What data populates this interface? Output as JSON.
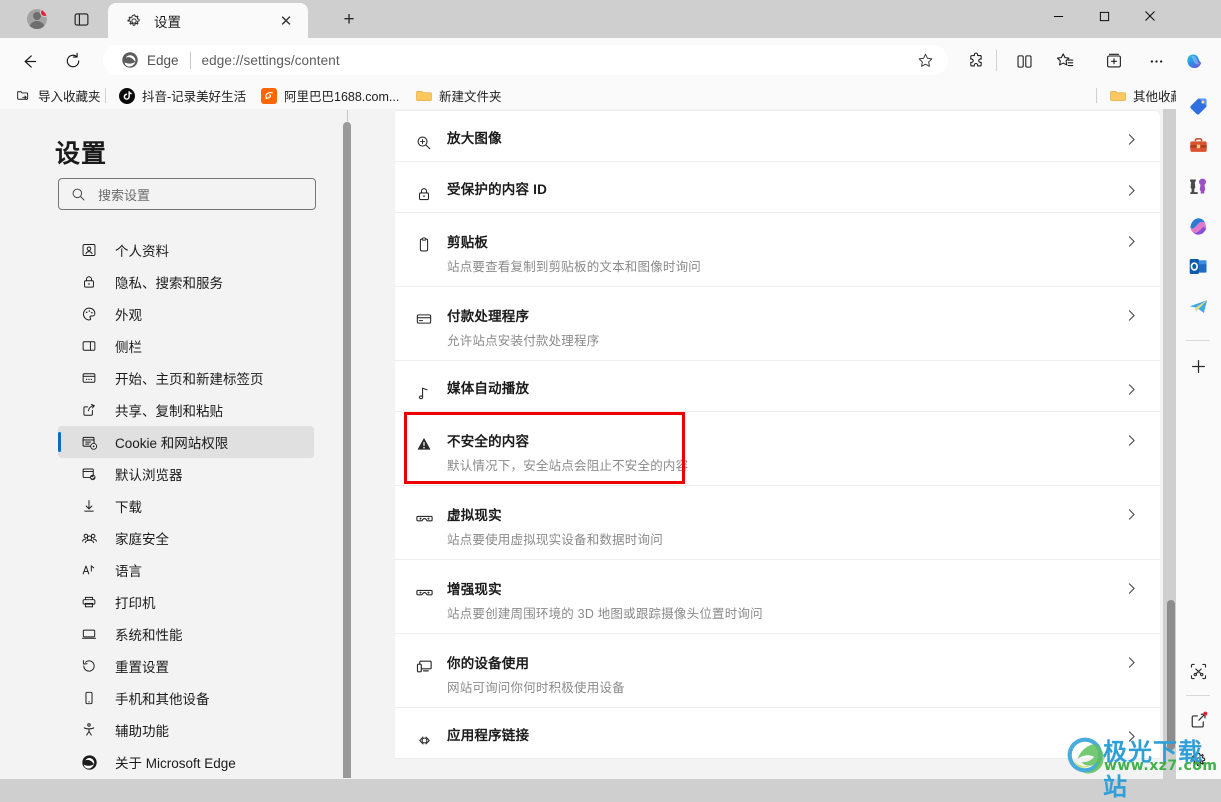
{
  "window": {
    "minimize_label": "—",
    "maximize_label": "□",
    "close_label": "✕"
  },
  "tab": {
    "title": "设置",
    "close_label": "✕",
    "new_tab_label": "+",
    "icon": "gear-icon"
  },
  "toolbar": {
    "back_icon": "back-arrow-icon",
    "reload_icon": "reload-icon",
    "omnibox": {
      "brand": "Edge",
      "url": "edge://settings/content",
      "star_icon": "favorite-star-icon"
    },
    "extensions_icon": "extensions-puzzle-icon",
    "split_screen_icon": "split-screen-icon",
    "favorites_icon": "favorites-star-list-icon",
    "collections_icon": "collections-icon",
    "more_icon": "more-ellipsis-icon",
    "copilot_icon": "copilot-icon"
  },
  "bookmarks": [
    {
      "label": "导入收藏夹",
      "icon": "import-favorites-icon"
    },
    {
      "label": "抖音-记录美好生活",
      "icon": "douyin-icon"
    },
    {
      "label": "阿里巴巴1688.com...",
      "icon": "alibaba-icon"
    },
    {
      "label": "新建文件夹",
      "icon": "folder-icon"
    }
  ],
  "bookmarks_right": {
    "label": "其他收藏夹",
    "icon": "folder-icon"
  },
  "settings": {
    "title": "设置",
    "search_placeholder": "搜索设置",
    "search_value": "",
    "nav": [
      {
        "label": "个人资料",
        "icon": "profile-icon",
        "selected": false
      },
      {
        "label": "隐私、搜索和服务",
        "icon": "lock-icon",
        "selected": false
      },
      {
        "label": "外观",
        "icon": "palette-icon",
        "selected": false
      },
      {
        "label": "侧栏",
        "icon": "sidebar-icon",
        "selected": false
      },
      {
        "label": "开始、主页和新建标签页",
        "icon": "home-page-icon",
        "selected": false
      },
      {
        "label": "共享、复制和粘贴",
        "icon": "share-icon",
        "selected": false
      },
      {
        "label": "Cookie 和网站权限",
        "icon": "cookie-permissions-icon",
        "selected": true
      },
      {
        "label": "默认浏览器",
        "icon": "default-browser-icon",
        "selected": false
      },
      {
        "label": "下载",
        "icon": "download-icon",
        "selected": false
      },
      {
        "label": "家庭安全",
        "icon": "family-safety-icon",
        "selected": false
      },
      {
        "label": "语言",
        "icon": "language-icon",
        "selected": false
      },
      {
        "label": "打印机",
        "icon": "printer-icon",
        "selected": false
      },
      {
        "label": "系统和性能",
        "icon": "system-performance-icon",
        "selected": false
      },
      {
        "label": "重置设置",
        "icon": "reset-icon",
        "selected": false
      },
      {
        "label": "手机和其他设备",
        "icon": "phone-devices-icon",
        "selected": false
      },
      {
        "label": "辅助功能",
        "icon": "accessibility-icon",
        "selected": false
      },
      {
        "label": "关于 Microsoft Edge",
        "icon": "edge-logo-icon",
        "selected": false
      }
    ]
  },
  "content": {
    "highlight_color": "#ee0000",
    "highlighted_row_index": 5,
    "rows": [
      {
        "title": "放大图像",
        "sub": "",
        "icon": "zoom-image-icon"
      },
      {
        "title": "受保护的内容 ID",
        "sub": "",
        "icon": "lock-icon"
      },
      {
        "title": "剪贴板",
        "sub": "站点要查看复制到剪贴板的文本和图像时询问",
        "icon": "clipboard-icon"
      },
      {
        "title": "付款处理程序",
        "sub": "允许站点安装付款处理程序",
        "icon": "payment-card-icon"
      },
      {
        "title": "媒体自动播放",
        "sub": "",
        "icon": "music-note-icon"
      },
      {
        "title": "不安全的内容",
        "sub": "默认情况下，安全站点会阻止不安全的内容",
        "icon": "warning-triangle-icon"
      },
      {
        "title": "虚拟现实",
        "sub": "站点要使用虚拟现实设备和数据时询问",
        "icon": "vr-goggles-icon"
      },
      {
        "title": "增强现实",
        "sub": "站点要创建周围环境的 3D 地图或跟踪摄像头位置时询问",
        "icon": "ar-goggles-icon"
      },
      {
        "title": "你的设备使用",
        "sub": "网站可询问你何时积极使用设备",
        "icon": "device-usage-icon"
      },
      {
        "title": "应用程序链接",
        "sub": "",
        "icon": "app-links-icon"
      }
    ]
  },
  "edge_sidebar": {
    "items": [
      {
        "icon": "shopping-tag-icon"
      },
      {
        "icon": "toolbox-icon"
      },
      {
        "icon": "games-icon"
      },
      {
        "icon": "microsoft-365-icon"
      },
      {
        "icon": "outlook-icon"
      },
      {
        "icon": "telegram-icon"
      },
      {
        "icon": "add-plus-icon"
      },
      {
        "icon": "screenshot-icon"
      },
      {
        "icon": "open-external-icon"
      },
      {
        "icon": "settings-gear-icon"
      }
    ],
    "add_label": "+"
  },
  "watermark": {
    "line1": "极光下载站",
    "line2": "www.xz7.com"
  }
}
